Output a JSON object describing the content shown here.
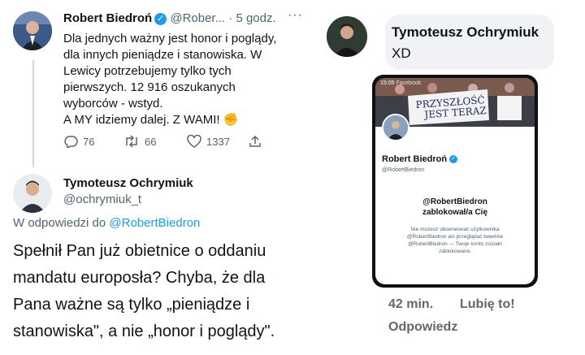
{
  "tweet": {
    "author_name": "Robert Biedroń",
    "author_handle": "@Rober...",
    "time": "· 5 godz.",
    "more_icon": "more-dots-icon",
    "lines": [
      "Dla jednych ważny jest honor i poglądy,",
      "dla innych pieniądze i stanowiska. W",
      "Lewicy potrzebujemy tylko tych",
      "pierwszych. 12 916 oszukanych",
      "wyborców - wstyd.",
      "A MY idziemy dalej. Z WAMI! ✊"
    ],
    "replies": "76",
    "retweets": "66",
    "likes": "1337"
  },
  "reply": {
    "author_name": "Tymoteusz Ochrymiuk",
    "author_handle": "@ochrymiuk_t",
    "reply_to_prefix": "W odpowiedzi do",
    "reply_to_handle": "@RobertBiedron",
    "lines": [
      "Spełnił Pan już obietnice o oddaniu",
      "mandatu europosła? Chyba, że dla",
      "Pana ważne są tylko „pieniądze i",
      "stanowiska\", a nie „honor i poglądy\"."
    ]
  },
  "comment": {
    "author_name": "Tymoteusz Ochrymiuk",
    "text": "XD",
    "time": "42 min.",
    "like_label": "Lubię to!",
    "reply_label": "Odpowiedz"
  },
  "screenshot": {
    "status_time": "15:05",
    "status_app": "Facebook",
    "banner_line1": "PRZYSZŁOŚĆ",
    "banner_line2": "JEST TERAZ",
    "profile_name": "Robert Biedroń",
    "profile_handle": "@RobertBiedron",
    "blocked_title_1": "@RobertBiedron",
    "blocked_title_2": "zablokował/a Cię",
    "blocked_desc": [
      "Nie możesz obserwować użytkownika",
      "@RobertBiedron ani przeglądać tweetów",
      "@RobertBiedron — Twoje konto zostało",
      "zablokowane."
    ]
  },
  "colors": {
    "link": "#1d9bf0",
    "muted": "#536471",
    "bubble": "#f0f2f5"
  }
}
